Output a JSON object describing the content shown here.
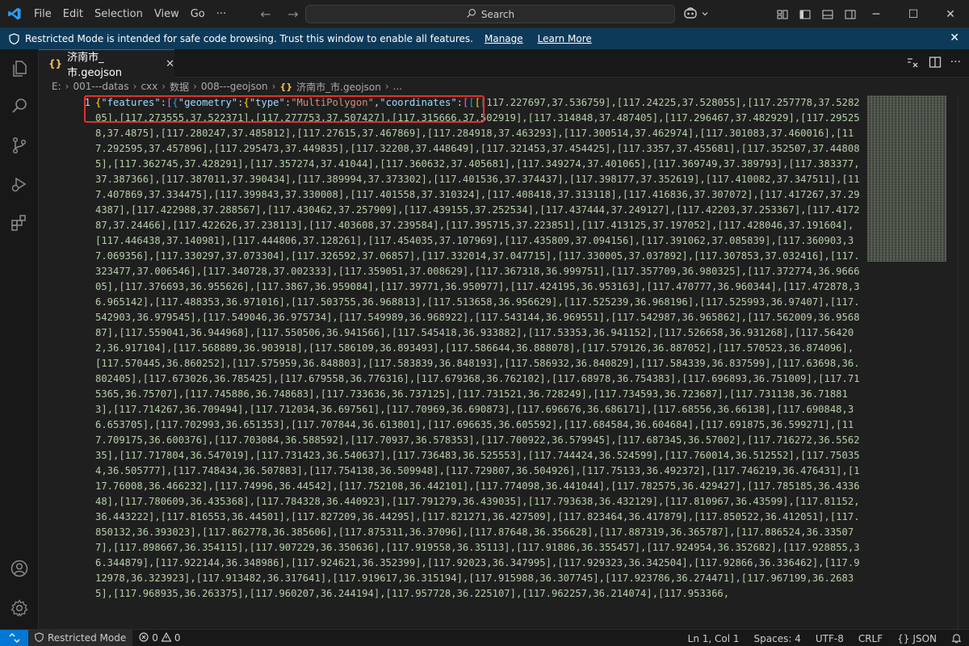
{
  "titlebar": {
    "menu": [
      "File",
      "Edit",
      "Selection",
      "View",
      "Go",
      "···"
    ],
    "search_label": "Search"
  },
  "banner": {
    "message": "Restricted Mode is intended for safe code browsing. Trust this window to enable all features.",
    "manage": "Manage",
    "learn_more": "Learn More"
  },
  "tab": {
    "label": "济南市_市.geojson"
  },
  "breadcrumb": [
    "E:",
    "001---datas",
    "cxx",
    "数据",
    "008---geojson",
    "济南市_市.geojson",
    "..."
  ],
  "editor": {
    "line_number": "1",
    "json_prefix": {
      "features_key": "\"features\"",
      "geometry_key": "\"geometry\"",
      "type_key": "\"type\"",
      "type_value": "\"MultiPolygon\"",
      "coordinates_key": "\"coordinates\""
    },
    "code_text": "[117.227697,37.536759],[117.24225,37.528055],[117.257778,37.528205],[117.273555,37.522371],[117.277753,37.507427],[117.315666,37.502919],[117.314848,37.487405],[117.296467,37.482929],[117.295258,37.4875],[117.280247,37.485812],[117.27615,37.467869],[117.284918,37.463293],[117.300514,37.462974],[117.301083,37.460016],[117.292595,37.457896],[117.295473,37.449835],[117.32208,37.448649],[117.321453,37.454425],[117.3357,37.455681],[117.352507,37.448085],[117.362745,37.428291],[117.357274,37.41044],[117.360632,37.405681],[117.349274,37.401065],[117.369749,37.389793],[117.383377,37.387366],[117.387011,37.390434],[117.389994,37.373302],[117.401536,37.374437],[117.398177,37.352619],[117.410082,37.347511],[117.407869,37.334475],[117.399843,37.330008],[117.401558,37.310324],[117.408418,37.313118],[117.416836,37.307072],[117.417267,37.294387],[117.422988,37.288567],[117.430462,37.257909],[117.439155,37.252534],[117.437444,37.249127],[117.42203,37.253367],[117.417287,37.24466],[117.422626,37.238113],[117.403608,37.239584],[117.395715,37.223851],[117.413125,37.197052],[117.428046,37.191604],[117.446438,37.140981],[117.444806,37.128261],[117.454035,37.107969],[117.435809,37.094156],[117.391062,37.085839],[117.360903,37.069356],[117.330297,37.073304],[117.326592,37.06857],[117.332014,37.047715],[117.330005,37.037892],[117.307853,37.032416],[117.323477,37.006546],[117.340728,37.002333],[117.359051,37.008629],[117.367318,36.999751],[117.357709,36.980325],[117.372774,36.966605],[117.376693,36.955626],[117.3867,36.959084],[117.39771,36.950977],[117.424195,36.953163],[117.470777,36.960344],[117.472878,36.965142],[117.488353,36.971016],[117.503755,36.968813],[117.513658,36.956629],[117.525239,36.968196],[117.525993,36.97407],[117.542903,36.979545],[117.549046,36.975734],[117.549989,36.968922],[117.543144,36.969551],[117.542987,36.965862],[117.562009,36.956887],[117.559041,36.944968],[117.550506,36.941566],[117.545418,36.933882],[117.53353,36.941152],[117.526658,36.931268],[117.564202,36.917104],[117.568889,36.903918],[117.586109,36.893493],[117.586644,36.888078],[117.579126,36.887052],[117.570523,36.874096],[117.570445,36.860252],[117.575959,36.848803],[117.583839,36.848193],[117.586932,36.840829],[117.584339,36.837599],[117.63698,36.802405],[117.673026,36.785425],[117.679558,36.776316],[117.679368,36.762102],[117.68978,36.754383],[117.696893,36.751009],[117.715365,36.75707],[117.745886,36.748683],[117.733636,36.737125],[117.731521,36.728249],[117.734593,36.723687],[117.731138,36.718813],[117.714267,36.709494],[117.712034,36.697561],[117.70969,36.690873],[117.696676,36.686171],[117.68556,36.66138],[117.690848,36.653705],[117.702993,36.651353],[117.707844,36.613801],[117.696635,36.605592],[117.684584,36.604684],[117.691875,36.599271],[117.709175,36.600376],[117.703084,36.588592],[117.70937,36.578353],[117.700922,36.579945],[117.687345,36.57002],[117.716272,36.556235],[117.717804,36.547019],[117.731423,36.540637],[117.736483,36.525553],[117.744424,36.524599],[117.760014,36.512552],[117.750354,36.505777],[117.748434,36.507883],[117.754138,36.509948],[117.729807,36.504926],[117.75133,36.492372],[117.746219,36.476431],[117.76008,36.466232],[117.74996,36.44542],[117.752108,36.442101],[117.774098,36.441044],[117.782575,36.429427],[117.785185,36.433648],[117.780609,36.435368],[117.784328,36.440923],[117.791279,36.439035],[117.793638,36.432129],[117.810967,36.43599],[117.81152,36.443222],[117.816553,36.44501],[117.827209,36.44295],[117.821271,36.427509],[117.823464,36.417879],[117.850522,36.412051],[117.850132,36.393023],[117.862778,36.385606],[117.875311,36.37096],[117.87648,36.356628],[117.887319,36.365787],[117.886524,36.335077],[117.898667,36.354115],[117.907229,36.350636],[117.919558,36.35113],[117.91886,36.355457],[117.924954,36.352682],[117.928855,36.344879],[117.922144,36.348986],[117.924621,36.352399],[117.92023,36.347995],[117.929323,36.342504],[117.92866,36.336462],[117.912978,36.323923],[117.913482,36.317641],[117.919617,36.315194],[117.915988,36.307745],[117.923786,36.274471],[117.967199,36.26835],[117.968935,36.263375],[117.960207,36.244194],[117.957728,36.225107],[117.962257,36.214074],[117.953366,"
  },
  "statusbar": {
    "restricted": "Restricted Mode",
    "errors": "0",
    "warnings": "0",
    "position": "Ln 1, Col 1",
    "spaces": "Spaces: 4",
    "encoding": "UTF-8",
    "eol": "CRLF",
    "language": "JSON"
  },
  "colors": {
    "accent": "#0078d4",
    "banner_bg": "#0e3a5a",
    "number": "#b5cea8",
    "key": "#9cdcfe",
    "string": "#ce9178",
    "highlight_box": "#e03131"
  }
}
